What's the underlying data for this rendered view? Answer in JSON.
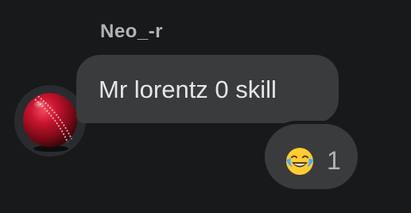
{
  "message": {
    "sender": "Neo_-r",
    "text": "Mr lorentz 0 skill",
    "avatar_icon": "cricket-ball-icon",
    "reaction": {
      "emoji_icon": "face-with-tears-of-joy-icon",
      "count": "1"
    }
  },
  "colors": {
    "background": "#18191a",
    "bubble": "#3a3b3c",
    "text": "#e4e6eb",
    "muted_text": "#b0b3b8",
    "ball_red": "#c1122a"
  }
}
